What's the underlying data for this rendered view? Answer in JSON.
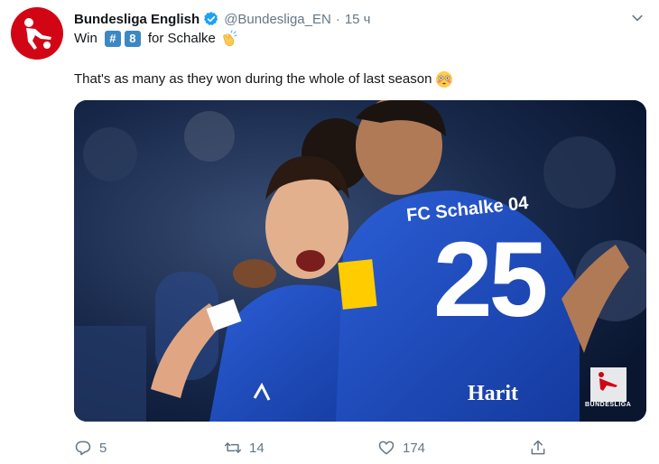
{
  "tweet": {
    "author_name": "Bundesliga English",
    "handle": "@Bundesliga_EN",
    "separator": "·",
    "time": "15 ч",
    "line1_prefix": "Win",
    "keycap_hash": "#",
    "keycap_number": "8",
    "line1_suffix": "for Schalke",
    "line2": "That's as many as they won during the whole of last season",
    "line1_emoji": "clapping-hands-emoji",
    "line2_emoji": "flushed-face-emoji"
  },
  "media": {
    "jersey_sponsor_text": "FC Schalke 04",
    "jersey_number": "25",
    "jersey_name": "Harit",
    "watermark_label": "BUNDESLIGA",
    "shirt_color": "#1a47b8"
  },
  "actions": {
    "reply_count": "5",
    "retweet_count": "14",
    "like_count": "174"
  },
  "colors": {
    "brand_red": "#d20515",
    "verified_blue": "#1da1f2",
    "muted": "#657786",
    "keycap_blue": "#3b88c3"
  }
}
